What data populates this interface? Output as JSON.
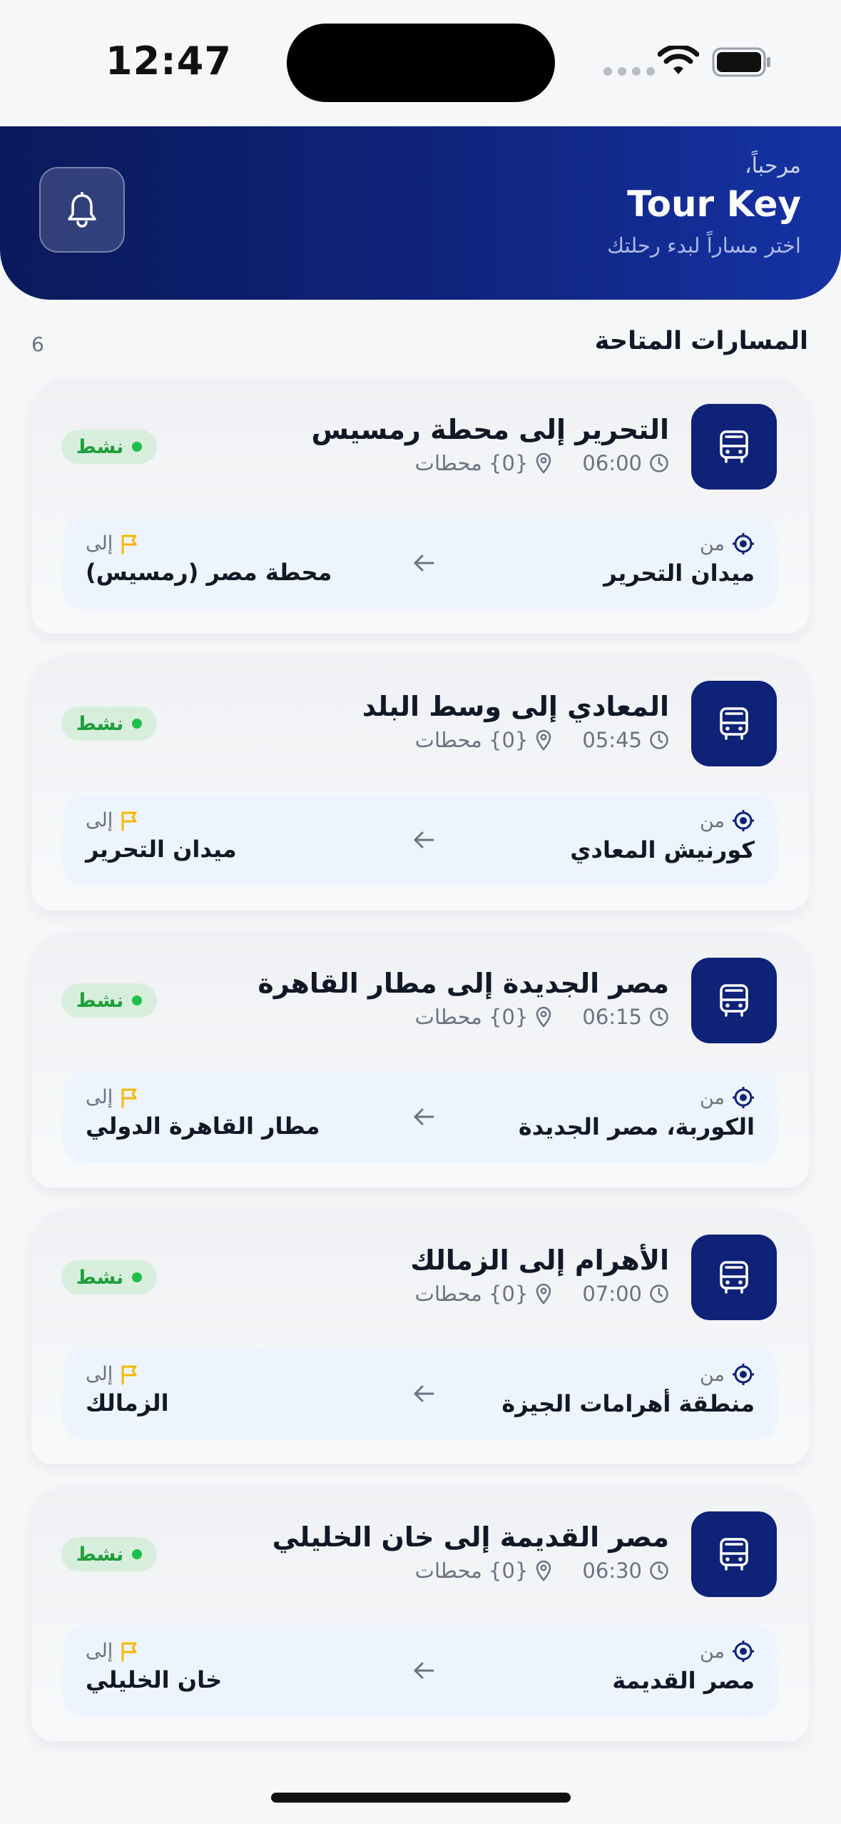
{
  "status_bar": {
    "time": "12:47"
  },
  "header": {
    "greeting": "مرحباً،",
    "brand": "Tour Key",
    "subtitle": "اختر مساراً لبدء رحلتك"
  },
  "section": {
    "title": "المسارات المتاحة",
    "count": "6"
  },
  "labels": {
    "from": "من",
    "to": "إلى",
    "active": "نشط"
  },
  "routes": [
    {
      "title": "التحرير إلى محطة رمسيس",
      "time": "06:00",
      "stops": "{0} محطات",
      "from": "ميدان التحرير",
      "to": "محطة مصر (رمسيس)"
    },
    {
      "title": "المعادي إلى وسط البلد",
      "time": "05:45",
      "stops": "{0} محطات",
      "from": "كورنيش المعادي",
      "to": "ميدان التحرير"
    },
    {
      "title": "مصر الجديدة إلى مطار القاهرة",
      "time": "06:15",
      "stops": "{0} محطات",
      "from": "الكوربة، مصر الجديدة",
      "to": "مطار القاهرة الدولي"
    },
    {
      "title": "الأهرام إلى الزمالك",
      "time": "07:00",
      "stops": "{0} محطات",
      "from": "منطقة أهرامات الجيزة",
      "to": "الزمالك"
    },
    {
      "title": "مصر القديمة إلى خان الخليلي",
      "time": "06:30",
      "stops": "{0} محطات",
      "from": "مصر القديمة",
      "to": "خان الخليلي"
    }
  ],
  "colors": {
    "header_start": "#0a1a5c",
    "header_end": "#1633a5",
    "bus_tile": "#0e2277",
    "active_green": "#1e9e3a",
    "flag_yellow": "#f5b700",
    "route_box": "#eef4fe"
  },
  "icons": {
    "bell": "bell-icon",
    "bus": "bus-icon",
    "clock": "clock-icon",
    "pin": "map-pin-icon",
    "origin": "target-icon",
    "destination": "flag-icon",
    "direction": "arrow-left-icon"
  }
}
